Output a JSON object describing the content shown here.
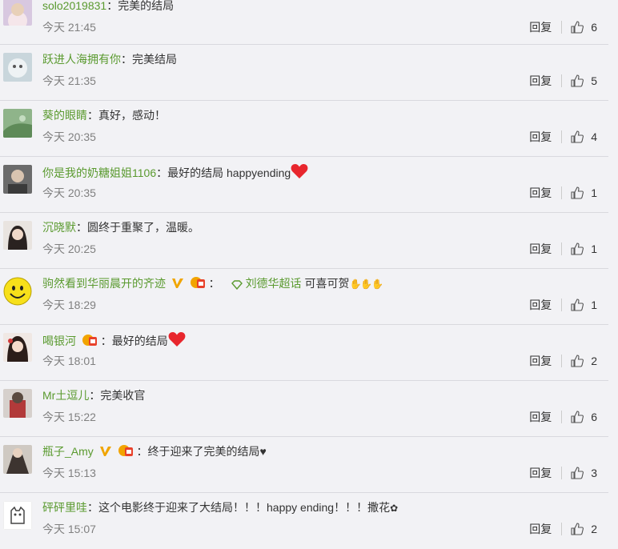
{
  "comments": [
    {
      "user": "solo2019831",
      "text": "完美的结局",
      "time": "今天 21:45",
      "likes": "6"
    },
    {
      "user": "跃进人海拥有你",
      "text": "完美结局",
      "time": "今天 21:35",
      "likes": "5"
    },
    {
      "user": "葵的眼睛",
      "text": "真好，感动！",
      "time": "今天 20:35",
      "likes": "4"
    },
    {
      "user": "你是我的奶糖姐姐1106",
      "text": "最好的结局  happyending",
      "time": "今天 20:35",
      "likes": "1"
    },
    {
      "user": "沉晓默",
      "text": "圆终于重聚了，温暖。",
      "time": "今天 20:25",
      "likes": "1"
    },
    {
      "user": "驹然看到华丽晨开的齐迹",
      "topic": "刘德华超话",
      "text": "可喜可贺",
      "time": "今天 18:29",
      "likes": "1"
    },
    {
      "user": "喝银河",
      "text": "最好的结局",
      "time": "今天 18:01",
      "likes": "2"
    },
    {
      "user": "Mr土逗儿",
      "text": "完美收官",
      "time": "今天 15:22",
      "likes": "6"
    },
    {
      "user": "瓶子_Amy",
      "text": "终于迎来了完美的结局",
      "time": "今天 15:13",
      "likes": "3"
    },
    {
      "user": "砰砰里哇",
      "text": "这个电影终于迎来了大结局！！！happy ending！！！撒花",
      "time": "今天 15:07",
      "likes": "2"
    }
  ],
  "labels": {
    "reply": "回复",
    "separator": "："
  },
  "colors": {
    "username": "#5a9a2f",
    "background": "#f2f2f5",
    "divider": "#d9d9de",
    "time": "#808080",
    "heart": "#e8262d"
  }
}
